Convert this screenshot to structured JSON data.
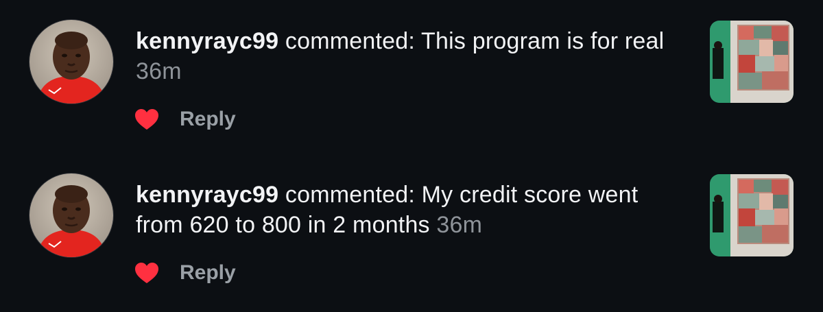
{
  "notifications": [
    {
      "username": "kennyrayc99",
      "action": "commented:",
      "comment": "This program is for real",
      "time": "36m",
      "reply_label": "Reply",
      "liked": true
    },
    {
      "username": "kennyrayc99",
      "action": "commented:",
      "comment": "My credit score went from 620 to 800 in 2 months",
      "time": "36m",
      "reply_label": "Reply",
      "liked": true
    }
  ],
  "colors": {
    "background": "#0c0f13",
    "text": "#f2f3f5",
    "muted": "#8e9399",
    "heart": "#ff3040"
  },
  "icons": [
    "heart-icon"
  ]
}
